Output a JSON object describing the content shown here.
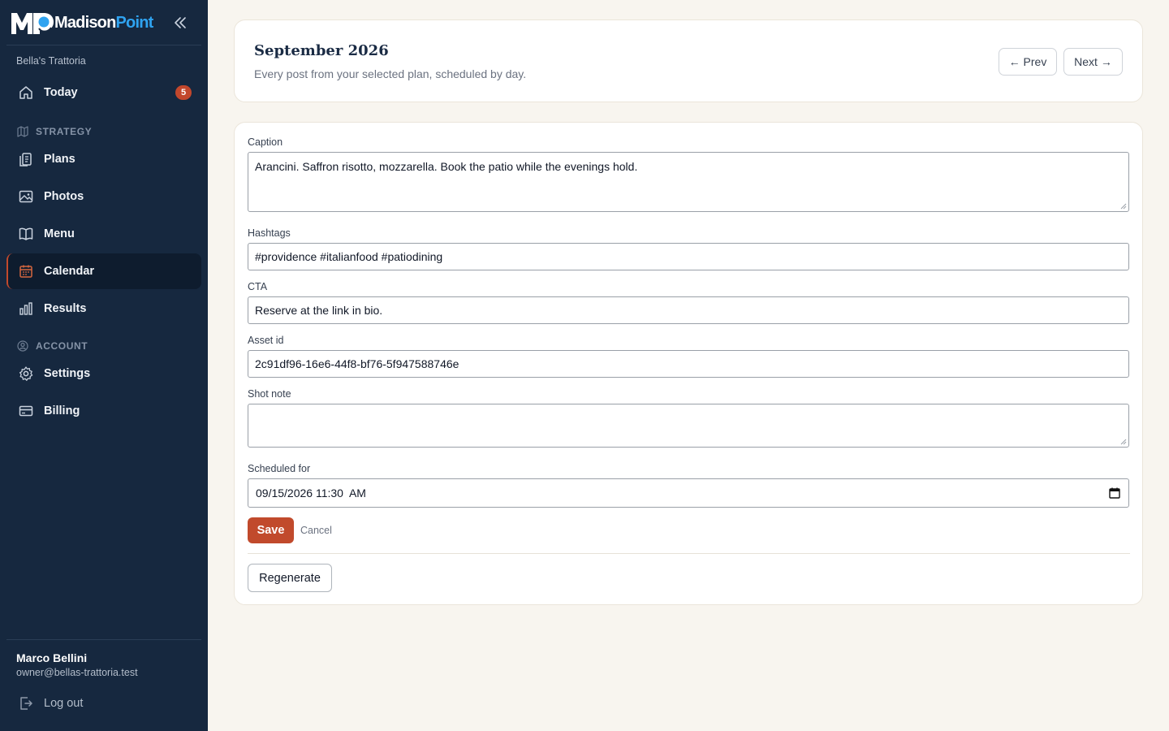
{
  "brand": {
    "name_part1": "Madison",
    "name_part2": "Point",
    "logo_initials": "MP"
  },
  "sidebar": {
    "workspace": "Bella's Trattoria",
    "today": {
      "label": "Today",
      "badge": "5",
      "icon": "home-icon"
    },
    "strategy_label": "STRATEGY",
    "strategy_items": [
      {
        "label": "Plans",
        "icon": "clipboard-icon"
      },
      {
        "label": "Photos",
        "icon": "image-icon"
      },
      {
        "label": "Menu",
        "icon": "book-icon"
      },
      {
        "label": "Calendar",
        "icon": "calendar-icon",
        "active": true
      },
      {
        "label": "Results",
        "icon": "bar-chart-icon"
      }
    ],
    "account_label": "ACCOUNT",
    "account_items": [
      {
        "label": "Settings",
        "icon": "gear-icon"
      },
      {
        "label": "Billing",
        "icon": "credit-card-icon"
      }
    ],
    "user": {
      "name": "Marco Bellini",
      "email": "owner@bellas-trattoria.test"
    },
    "logout_label": "Log out"
  },
  "header": {
    "title": "September 2026",
    "subtitle": "Every post from your selected plan, scheduled by day.",
    "prev_label": "← Prev",
    "next_label": "Next →"
  },
  "form": {
    "caption": {
      "label": "Caption",
      "value": "Arancini. Saffron risotto, mozzarella. Book the patio while the evenings hold."
    },
    "hashtags": {
      "label": "Hashtags",
      "value": "#providence #italianfood #patiodining"
    },
    "cta": {
      "label": "CTA",
      "value": "Reserve at the link in bio."
    },
    "asset_id": {
      "label": "Asset id",
      "value": "2c91df96-16e6-44f8-bf76-5f947588746e"
    },
    "shot_note": {
      "label": "Shot note",
      "value": ""
    },
    "scheduled_for": {
      "label": "Scheduled for",
      "value": "09/15/2026 11:30  AM"
    },
    "save_label": "Save",
    "cancel_label": "Cancel",
    "regenerate_label": "Regenerate"
  },
  "colors": {
    "sidebar_bg": "#16283f",
    "accent": "#c14a2c",
    "brand_blue": "#2fa3f0",
    "page_bg": "#f8f5ef"
  }
}
